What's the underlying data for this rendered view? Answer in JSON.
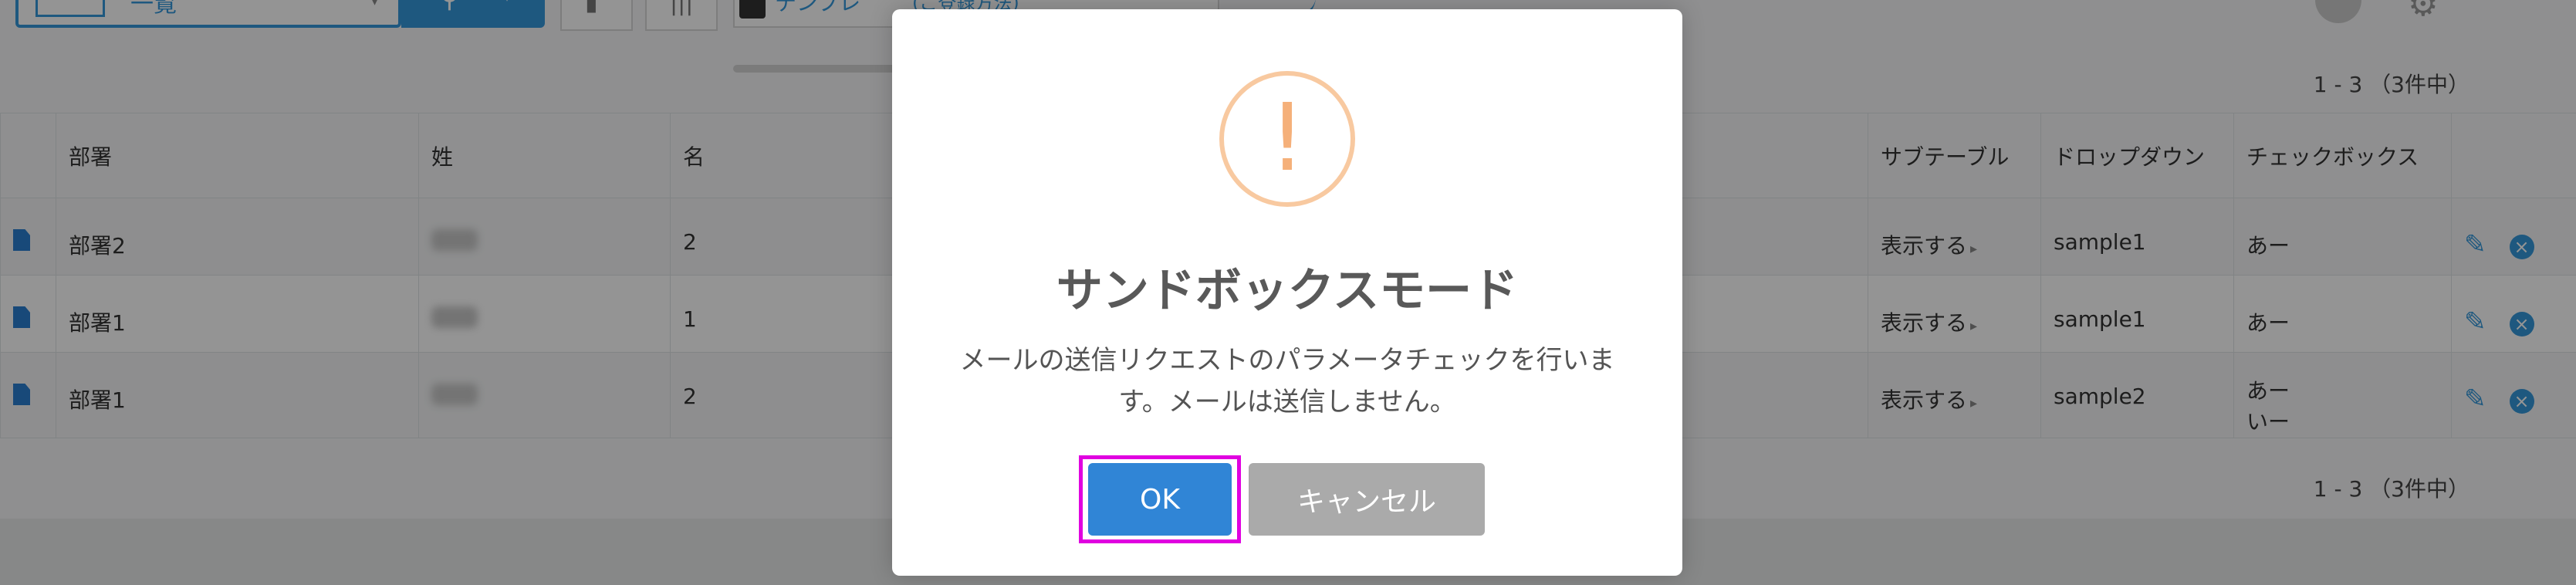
{
  "toolbar": {
    "view_name": "一覧",
    "template_label": "テンプレ",
    "template_value": "(ご登録方法)"
  },
  "pagination": {
    "top": "1 - 3 （3件中）",
    "bottom": "1 - 3 （3件中）"
  },
  "table": {
    "headers": {
      "dept": "部署",
      "last": "姓",
      "first": "名",
      "subtable": "サブテーブル",
      "dropdown": "ドロップダウン",
      "checkbox": "チェックボックス"
    },
    "rows": [
      {
        "dept": "部署2",
        "first": "2",
        "subtable": "表示する",
        "dropdown": "sample1",
        "checkbox": "あー"
      },
      {
        "dept": "部署1",
        "first": "1",
        "subtable": "表示する",
        "dropdown": "sample1",
        "checkbox": "あー"
      },
      {
        "dept": "部署1",
        "first": "2",
        "subtable": "表示する",
        "dropdown": "sample2",
        "checkbox": "あー\nいー"
      }
    ]
  },
  "dialog": {
    "icon": "warning-icon",
    "icon_glyph": "!",
    "title": "サンドボックスモード",
    "message": "メールの送信リクエストのパラメータチェックを行います。メールは送信しません。",
    "ok_label": "OK",
    "cancel_label": "キャンセル"
  },
  "colors": {
    "accent": "#3498db",
    "ok_button": "#3085d6",
    "cancel_button": "#aaaaaa",
    "warning": "#f8bb86",
    "highlight": "#e000e0"
  }
}
